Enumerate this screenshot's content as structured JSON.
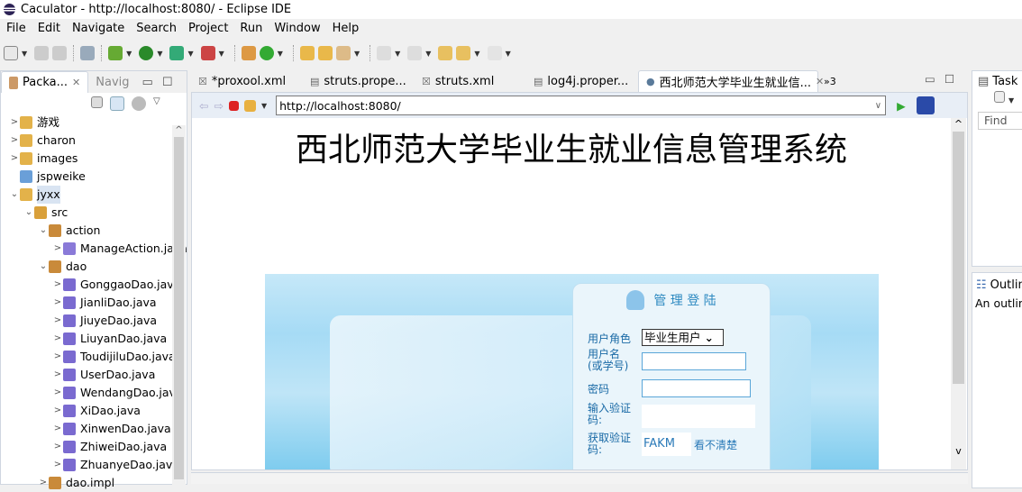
{
  "window": {
    "title": "Caculator - http://localhost:8080/ - Eclipse IDE"
  },
  "menu": [
    "File",
    "Edit",
    "Navigate",
    "Search",
    "Project",
    "Run",
    "Window",
    "Help"
  ],
  "left_panel": {
    "tabs": [
      "Packa...",
      "Navig"
    ],
    "tree": [
      {
        "label": "游戏",
        "level": 0,
        "expand": ">",
        "icon": "project-icon"
      },
      {
        "label": "charon",
        "level": 0,
        "expand": ">",
        "icon": "project-icon"
      },
      {
        "label": "images",
        "level": 0,
        "expand": ">",
        "icon": "project-icon"
      },
      {
        "label": "jspweike",
        "level": 0,
        "expand": "",
        "icon": "folder-icon"
      },
      {
        "label": "jyxx",
        "level": 0,
        "expand": "v",
        "icon": "project-icon",
        "selected": true
      },
      {
        "label": "src",
        "level": 1,
        "expand": "v",
        "icon": "source-folder-icon"
      },
      {
        "label": "action",
        "level": 2,
        "expand": "v",
        "icon": "package-icon"
      },
      {
        "label": "ManageAction.java",
        "level": 3,
        "expand": ">",
        "icon": "java-file-icon"
      },
      {
        "label": "dao",
        "level": 2,
        "expand": "v",
        "icon": "package-icon"
      },
      {
        "label": "GonggaoDao.java",
        "level": 3,
        "expand": ">",
        "icon": "java-interface-icon"
      },
      {
        "label": "JianliDao.java",
        "level": 3,
        "expand": ">",
        "icon": "java-interface-icon"
      },
      {
        "label": "JiuyeDao.java",
        "level": 3,
        "expand": ">",
        "icon": "java-interface-icon"
      },
      {
        "label": "LiuyanDao.java",
        "level": 3,
        "expand": ">",
        "icon": "java-interface-icon"
      },
      {
        "label": "ToudijiluDao.java",
        "level": 3,
        "expand": ">",
        "icon": "java-interface-icon"
      },
      {
        "label": "UserDao.java",
        "level": 3,
        "expand": ">",
        "icon": "java-interface-icon"
      },
      {
        "label": "WendangDao.java",
        "level": 3,
        "expand": ">",
        "icon": "java-interface-icon"
      },
      {
        "label": "XiDao.java",
        "level": 3,
        "expand": ">",
        "icon": "java-interface-icon"
      },
      {
        "label": "XinwenDao.java",
        "level": 3,
        "expand": ">",
        "icon": "java-interface-icon"
      },
      {
        "label": "ZhiweiDao.java",
        "level": 3,
        "expand": ">",
        "icon": "java-interface-icon"
      },
      {
        "label": "ZhuanyeDao.java",
        "level": 3,
        "expand": ">",
        "icon": "java-interface-icon"
      },
      {
        "label": "dao.impl",
        "level": 2,
        "expand": ">",
        "icon": "package-icon"
      }
    ]
  },
  "editor": {
    "tabs": [
      {
        "label": "*proxool.xml",
        "icon": "xml-icon"
      },
      {
        "label": "struts.prope...",
        "icon": "text-file-icon"
      },
      {
        "label": "struts.xml",
        "icon": "xml-icon"
      },
      {
        "label": "log4j.proper...",
        "icon": "text-file-icon"
      },
      {
        "label": "西北师范大学毕业生就业信...",
        "icon": "globe-icon",
        "active": true
      }
    ],
    "overflow": "»3"
  },
  "browser": {
    "url": "http://localhost:8080/"
  },
  "page": {
    "heading": "西北师范大学毕业生就业信息管理系统",
    "login": {
      "title": "管 理 登 陆",
      "role_label": "用户角色",
      "role_value": "毕业生用户",
      "username_label": "用户名\n(或学号)",
      "password_label": "密码",
      "captcha_input_label": "输入验证码:",
      "captcha_label": "获取验证码:",
      "captcha_value": "FAKM",
      "refresh_link": "看不清楚"
    }
  },
  "right_panel": {
    "task_tab": "Task",
    "find_placeholder": "Find",
    "outline_tab": "Outlin",
    "outline_text": "An outline"
  }
}
